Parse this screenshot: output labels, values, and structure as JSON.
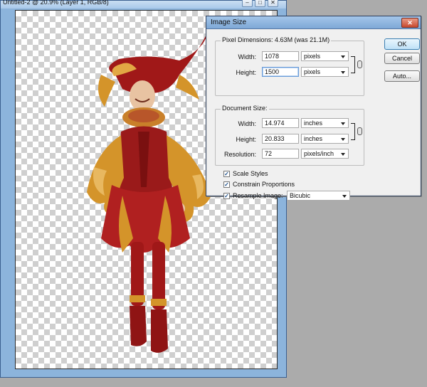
{
  "document_window": {
    "title": "Untitled-2 @ 20.9% (Layer 1, RGB/8)",
    "minimize_glyph": "–",
    "maximize_glyph": "□",
    "close_glyph": "✕"
  },
  "dialog": {
    "title": "Image Size",
    "close_glyph": "✕",
    "pixel_dimensions": {
      "label": "Pixel Dimensions:",
      "summary": "4.63M (was 21.1M)",
      "width_label": "Width:",
      "width_value": "1078",
      "width_unit": "pixels",
      "height_label": "Height:",
      "height_value": "1500",
      "height_unit": "pixels"
    },
    "document_size": {
      "label": "Document Size:",
      "width_label": "Width:",
      "width_value": "14.974",
      "width_unit": "inches",
      "height_label": "Height:",
      "height_value": "20.833",
      "height_unit": "inches",
      "resolution_label": "Resolution:",
      "resolution_value": "72",
      "resolution_unit": "pixels/inch"
    },
    "options": {
      "scale_styles": {
        "label": "Scale Styles",
        "checked": true
      },
      "constrain_proportions": {
        "label": "Constrain Proportions",
        "checked": true
      },
      "resample_image": {
        "label": "Resample Image:",
        "checked": true,
        "method": "Bicubic"
      }
    },
    "buttons": {
      "ok": "OK",
      "cancel": "Cancel",
      "auto": "Auto..."
    },
    "checkmark_glyph": "✓"
  },
  "colors": {
    "workspace": "#ababab",
    "window_border": "#8cb4dc",
    "dialog_title": "#7ea8d6",
    "close_button": "#c94a30",
    "jester_red": "#8f1414",
    "jester_gold": "#d4942a"
  }
}
